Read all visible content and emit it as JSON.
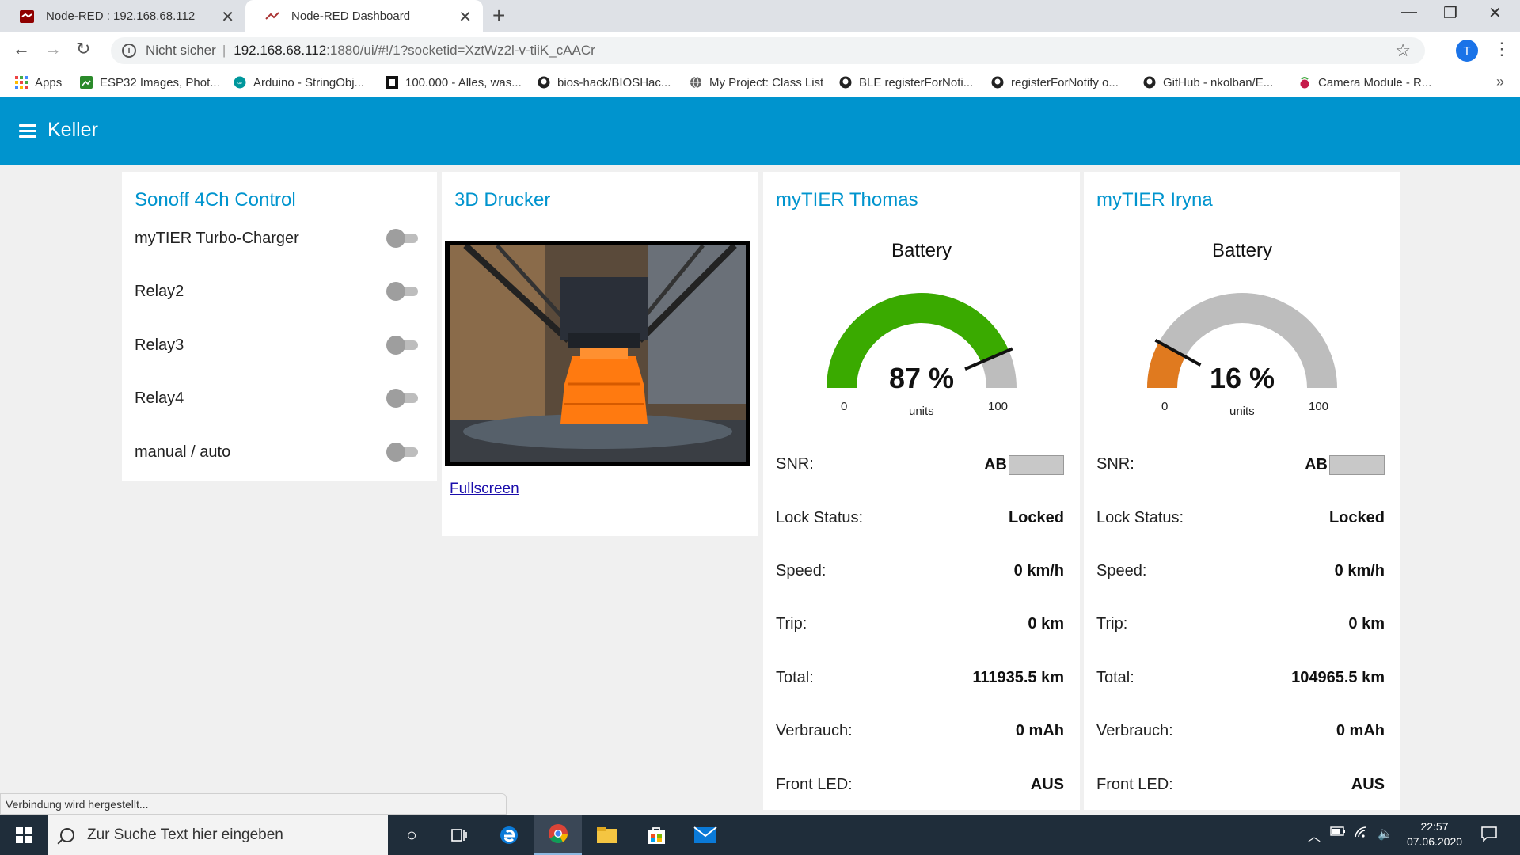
{
  "browser": {
    "tabs": [
      {
        "title": "Node-RED : 192.168.68.112",
        "active": false
      },
      {
        "title": "Node-RED Dashboard",
        "active": true
      }
    ],
    "address": {
      "security_label": "Nicht sicher",
      "separator": "|",
      "host": "192.168.68.112",
      "path": ":1880/ui/#!/1?socketid=XztWz2l-v-tiiK_cAACr"
    },
    "profile_initial": "T",
    "bookmarks": [
      {
        "label": "Apps",
        "icon": "apps-grid-icon"
      },
      {
        "label": "ESP32 Images, Phot...",
        "icon": "image-icon"
      },
      {
        "label": "Arduino - StringObj...",
        "icon": "arduino-icon"
      },
      {
        "label": "100.000 - Alles, was...",
        "icon": "page-icon"
      },
      {
        "label": "bios-hack/BIOSHac...",
        "icon": "github-icon"
      },
      {
        "label": "My Project: Class List",
        "icon": "globe-icon"
      },
      {
        "label": "BLE registerForNoti...",
        "icon": "github-icon"
      },
      {
        "label": "registerForNotify o...",
        "icon": "github-icon"
      },
      {
        "label": "GitHub - nkolban/E...",
        "icon": "github-icon"
      },
      {
        "label": "Camera Module - R...",
        "icon": "raspberry-icon"
      }
    ]
  },
  "dashboard": {
    "title": "Keller",
    "accent_color": "#0094ce",
    "sonoff": {
      "title": "Sonoff 4Ch Control",
      "switches": [
        {
          "label": "myTIER Turbo-Charger",
          "on": false
        },
        {
          "label": "Relay2",
          "on": false
        },
        {
          "label": "Relay3",
          "on": false
        },
        {
          "label": "Relay4",
          "on": false
        },
        {
          "label": "manual / auto",
          "on": false
        }
      ]
    },
    "printer": {
      "title": "3D Drucker",
      "fullscreen_label": "Fullscreen"
    },
    "scooters": [
      {
        "title": "myTIER Thomas",
        "gauge": {
          "title": "Battery",
          "value": 87,
          "display": "87 %",
          "unit": "units",
          "min": "0",
          "max": "100",
          "color": "#3aaa00"
        },
        "rows": [
          {
            "key": "SNR:",
            "value": "AB"
          },
          {
            "key": "Lock Status:",
            "value": "Locked"
          },
          {
            "key": "Speed:",
            "value": "0 km/h"
          },
          {
            "key": "Trip:",
            "value": "0 km"
          },
          {
            "key": "Total:",
            "value": "111935.5 km"
          },
          {
            "key": "Verbrauch:",
            "value": "0 mAh"
          },
          {
            "key": "Front LED:",
            "value": "AUS"
          }
        ]
      },
      {
        "title": "myTIER Iryna",
        "gauge": {
          "title": "Battery",
          "value": 16,
          "display": "16 %",
          "unit": "units",
          "min": "0",
          "max": "100",
          "color": "#e07a1f"
        },
        "rows": [
          {
            "key": "SNR:",
            "value": "AB"
          },
          {
            "key": "Lock Status:",
            "value": "Locked"
          },
          {
            "key": "Speed:",
            "value": "0 km/h"
          },
          {
            "key": "Trip:",
            "value": "0 km"
          },
          {
            "key": "Total:",
            "value": "104965.5 km"
          },
          {
            "key": "Verbrauch:",
            "value": "0 mAh"
          },
          {
            "key": "Front LED:",
            "value": "AUS"
          }
        ]
      }
    ]
  },
  "status_bar": "Verbindung wird hergestellt...",
  "taskbar": {
    "search_placeholder": "Zur Suche Text hier eingeben",
    "time": "22:57",
    "date": "07.06.2020"
  }
}
